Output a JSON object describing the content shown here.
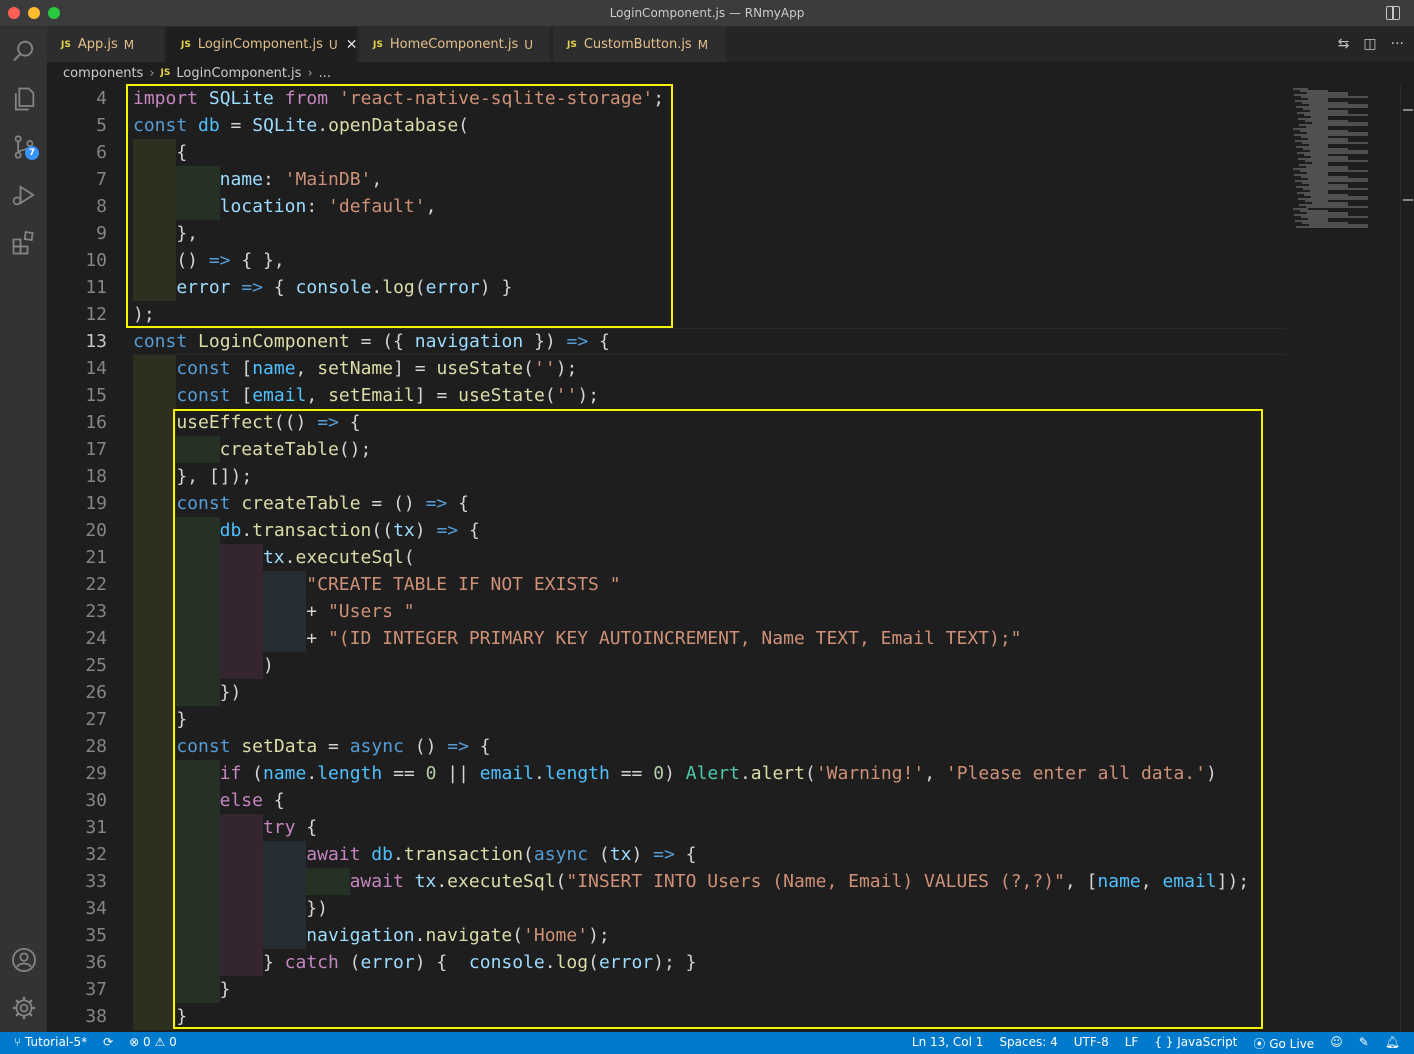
{
  "window": {
    "title": "LoginComponent.js — RNmyApp"
  },
  "activity_bar": {
    "scm_badge": "7"
  },
  "tabs": [
    {
      "name": "App.js",
      "status": "M",
      "active": false
    },
    {
      "name": "LoginComponent.js",
      "status": "U",
      "active": true
    },
    {
      "name": "HomeComponent.js",
      "status": "U",
      "active": false
    },
    {
      "name": "CustomButton.js",
      "status": "M",
      "active": false
    }
  ],
  "breadcrumb": {
    "folder": "components",
    "file": "LoginComponent.js",
    "more": "..."
  },
  "editor": {
    "current_line": 13,
    "lines": [
      {
        "n": "4"
      },
      {
        "n": "5"
      },
      {
        "n": "6"
      },
      {
        "n": "7"
      },
      {
        "n": "8"
      },
      {
        "n": "9"
      },
      {
        "n": "10"
      },
      {
        "n": "11"
      },
      {
        "n": "12"
      },
      {
        "n": "13"
      },
      {
        "n": "14"
      },
      {
        "n": "15"
      },
      {
        "n": "16"
      },
      {
        "n": "17"
      },
      {
        "n": "18"
      },
      {
        "n": "19"
      },
      {
        "n": "20"
      },
      {
        "n": "21"
      },
      {
        "n": "22"
      },
      {
        "n": "23"
      },
      {
        "n": "24"
      },
      {
        "n": "25"
      },
      {
        "n": "26"
      },
      {
        "n": "27"
      },
      {
        "n": "28"
      },
      {
        "n": "29"
      },
      {
        "n": "30"
      },
      {
        "n": "31"
      },
      {
        "n": "32"
      },
      {
        "n": "33"
      },
      {
        "n": "34"
      },
      {
        "n": "35"
      },
      {
        "n": "36"
      },
      {
        "n": "37"
      },
      {
        "n": "38"
      }
    ],
    "code": {
      "l4": [
        [
          "import",
          "kw"
        ],
        [
          " ",
          ""
        ],
        [
          "SQLite",
          "vr"
        ],
        [
          " ",
          ""
        ],
        [
          "from",
          "kw"
        ],
        [
          " ",
          ""
        ],
        [
          "'react-native-sqlite-storage'",
          "str"
        ],
        [
          ";",
          ""
        ]
      ],
      "l5": [
        [
          "const",
          "st-b"
        ],
        [
          " ",
          ""
        ],
        [
          "db",
          "vrc"
        ],
        [
          " = ",
          ""
        ],
        [
          "SQLite",
          "vr"
        ],
        [
          ".",
          ""
        ],
        [
          "openDatabase",
          "fn"
        ],
        [
          "(",
          ""
        ]
      ],
      "l6": [
        [
          "{",
          ""
        ]
      ],
      "l7": [
        [
          "name",
          "vr"
        ],
        [
          ": ",
          ""
        ],
        [
          "'MainDB'",
          "str"
        ],
        [
          ",",
          ""
        ]
      ],
      "l8": [
        [
          "location",
          "vr"
        ],
        [
          ": ",
          ""
        ],
        [
          "'default'",
          "str"
        ],
        [
          ",",
          ""
        ]
      ],
      "l9": [
        [
          "},",
          ""
        ]
      ],
      "l10": [
        [
          "() ",
          ""
        ],
        [
          "=>",
          "st-b"
        ],
        [
          " { },",
          ""
        ]
      ],
      "l11": [
        [
          "error",
          "vr"
        ],
        [
          " ",
          ""
        ],
        [
          "=>",
          "st-b"
        ],
        [
          " { ",
          ""
        ],
        [
          "console",
          "vr"
        ],
        [
          ".",
          ""
        ],
        [
          "log",
          "fn"
        ],
        [
          "(",
          ""
        ],
        [
          "error",
          "vr"
        ],
        [
          ") }",
          ""
        ]
      ],
      "l12": [
        [
          ");",
          ""
        ]
      ],
      "l13": [
        [
          "const",
          "st-b"
        ],
        [
          " ",
          ""
        ],
        [
          "LoginComponent",
          "fn"
        ],
        [
          " = ({ ",
          ""
        ],
        [
          "navigation",
          "vr"
        ],
        [
          " }) ",
          ""
        ],
        [
          "=>",
          "st-b"
        ],
        [
          " {",
          ""
        ]
      ],
      "l14": [
        [
          "const",
          "st-b"
        ],
        [
          " [",
          ""
        ],
        [
          "name",
          "vrc"
        ],
        [
          ", ",
          ""
        ],
        [
          "setName",
          "fn"
        ],
        [
          "] = ",
          ""
        ],
        [
          "useState",
          "fn"
        ],
        [
          "(",
          ""
        ],
        [
          "''",
          "str"
        ],
        [
          ");",
          ""
        ]
      ],
      "l15": [
        [
          "const",
          "st-b"
        ],
        [
          " [",
          ""
        ],
        [
          "email",
          "vrc"
        ],
        [
          ", ",
          ""
        ],
        [
          "setEmail",
          "fn"
        ],
        [
          "] = ",
          ""
        ],
        [
          "useState",
          "fn"
        ],
        [
          "(",
          ""
        ],
        [
          "''",
          "str"
        ],
        [
          ");",
          ""
        ]
      ],
      "l16": [
        [
          "useEffect",
          "fn"
        ],
        [
          "(() ",
          ""
        ],
        [
          "=>",
          "st-b"
        ],
        [
          " {",
          ""
        ]
      ],
      "l17": [
        [
          "createTable",
          "fn"
        ],
        [
          "();",
          ""
        ]
      ],
      "l18": [
        [
          "}, []);",
          ""
        ]
      ],
      "l19": [
        [
          "const",
          "st-b"
        ],
        [
          " ",
          ""
        ],
        [
          "createTable",
          "fn"
        ],
        [
          " = () ",
          ""
        ],
        [
          "=>",
          "st-b"
        ],
        [
          " {",
          ""
        ]
      ],
      "l20": [
        [
          "db",
          "vrc"
        ],
        [
          ".",
          ""
        ],
        [
          "transaction",
          "fn"
        ],
        [
          "((",
          ""
        ],
        [
          "tx",
          "vr"
        ],
        [
          ") ",
          ""
        ],
        [
          "=>",
          "st-b"
        ],
        [
          " {",
          ""
        ]
      ],
      "l21": [
        [
          "tx",
          "vr"
        ],
        [
          ".",
          ""
        ],
        [
          "executeSql",
          "fn"
        ],
        [
          "(",
          ""
        ]
      ],
      "l22": [
        [
          "\"CREATE TABLE IF NOT EXISTS \"",
          "str"
        ]
      ],
      "l23": [
        [
          "+ ",
          ""
        ],
        [
          "\"Users \"",
          "str"
        ]
      ],
      "l24": [
        [
          "+ ",
          ""
        ],
        [
          "\"(ID INTEGER PRIMARY KEY AUTOINCREMENT, Name TEXT, Email TEXT);\"",
          "str"
        ]
      ],
      "l25": [
        [
          ")",
          ""
        ]
      ],
      "l26": [
        [
          "})",
          ""
        ]
      ],
      "l27": [
        [
          "}",
          ""
        ]
      ],
      "l28": [
        [
          "const",
          "st-b"
        ],
        [
          " ",
          ""
        ],
        [
          "setData",
          "fn"
        ],
        [
          " = ",
          ""
        ],
        [
          "async",
          "st-b"
        ],
        [
          " () ",
          ""
        ],
        [
          "=>",
          "st-b"
        ],
        [
          " {",
          ""
        ]
      ],
      "l29": [
        [
          "if",
          "kw"
        ],
        [
          " (",
          ""
        ],
        [
          "name",
          "vrc"
        ],
        [
          ".",
          ""
        ],
        [
          "length",
          "vrc"
        ],
        [
          " == ",
          ""
        ],
        [
          "0",
          "num"
        ],
        [
          " || ",
          ""
        ],
        [
          "email",
          "vrc"
        ],
        [
          ".",
          ""
        ],
        [
          "length",
          "vrc"
        ],
        [
          " == ",
          ""
        ],
        [
          "0",
          "num"
        ],
        [
          ") ",
          ""
        ],
        [
          "Alert",
          "cls"
        ],
        [
          ".",
          ""
        ],
        [
          "alert",
          "fn"
        ],
        [
          "(",
          ""
        ],
        [
          "'Warning!'",
          "str"
        ],
        [
          ", ",
          ""
        ],
        [
          "'Please enter all data.'",
          "str"
        ],
        [
          ")",
          ""
        ]
      ],
      "l30": [
        [
          "else",
          "kw"
        ],
        [
          " {",
          ""
        ]
      ],
      "l31": [
        [
          "try",
          "kw"
        ],
        [
          " {",
          ""
        ]
      ],
      "l32": [
        [
          "await",
          "kw"
        ],
        [
          " ",
          ""
        ],
        [
          "db",
          "vrc"
        ],
        [
          ".",
          ""
        ],
        [
          "transaction",
          "fn"
        ],
        [
          "(",
          ""
        ],
        [
          "async",
          "st-b"
        ],
        [
          " (",
          ""
        ],
        [
          "tx",
          "vr"
        ],
        [
          ") ",
          ""
        ],
        [
          "=>",
          "st-b"
        ],
        [
          " {",
          ""
        ]
      ],
      "l33": [
        [
          "await",
          "kw"
        ],
        [
          " ",
          ""
        ],
        [
          "tx",
          "vr"
        ],
        [
          ".",
          ""
        ],
        [
          "executeSql",
          "fn"
        ],
        [
          "(",
          ""
        ],
        [
          "\"INSERT INTO Users (Name, Email) VALUES (?,?)\"",
          "str"
        ],
        [
          ", [",
          ""
        ],
        [
          "name",
          "vrc"
        ],
        [
          ", ",
          ""
        ],
        [
          "email",
          "vrc"
        ],
        [
          "]);",
          ""
        ]
      ],
      "l34": [
        [
          "})",
          ""
        ]
      ],
      "l35": [
        [
          "navigation",
          "vr"
        ],
        [
          ".",
          ""
        ],
        [
          "navigate",
          "fn"
        ],
        [
          "(",
          ""
        ],
        [
          "'Home'",
          "str"
        ],
        [
          ");",
          ""
        ]
      ],
      "l36": [
        [
          "} ",
          ""
        ],
        [
          "catch",
          "kw"
        ],
        [
          " (",
          ""
        ],
        [
          "error",
          "vr"
        ],
        [
          ") {  ",
          ""
        ],
        [
          "console",
          "vr"
        ],
        [
          ".",
          ""
        ],
        [
          "log",
          "fn"
        ],
        [
          "(",
          ""
        ],
        [
          "error",
          "vr"
        ],
        [
          "); }",
          ""
        ]
      ],
      "l37": [
        [
          "}",
          ""
        ]
      ],
      "l38": [
        [
          "}",
          ""
        ]
      ]
    }
  },
  "status_bar": {
    "branch": "Tutorial-5*",
    "errors": "0",
    "warnings": "0",
    "cursor": "Ln 13, Col 1",
    "spaces": "Spaces: 4",
    "encoding": "UTF-8",
    "eol": "LF",
    "language": "JavaScript",
    "golive": "Go Live"
  },
  "colors": {
    "statusbar": "#007acc",
    "highlight_box": "#f5f500",
    "keyword": "#c586c0",
    "storage": "#569cd6",
    "string": "#ce9178",
    "function": "#dcdcaa"
  }
}
